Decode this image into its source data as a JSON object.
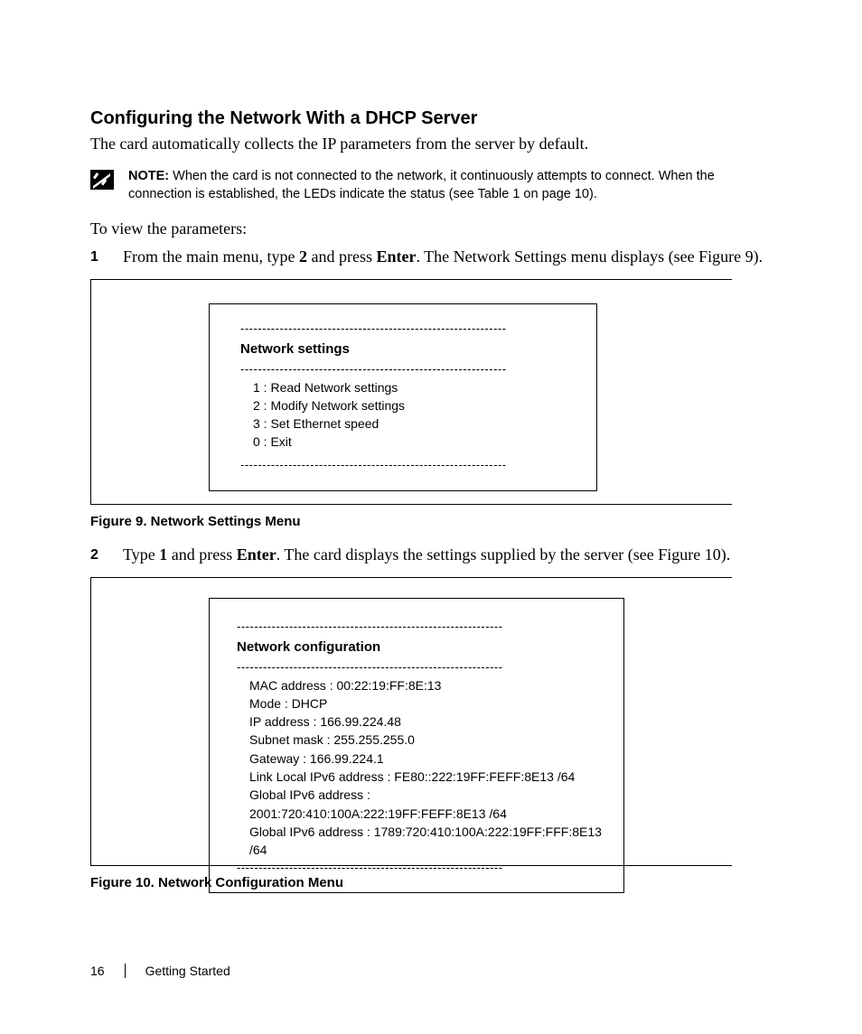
{
  "title": "Configuring the Network With a DHCP Server",
  "intro": "The card automatically collects the IP parameters from the server by default.",
  "note": {
    "label": "NOTE:",
    "text": " When the card is not connected to the network, it continuously attempts to connect. When the connection is established, the LEDs indicate the status (see Table 1 on page 10)."
  },
  "view_params": "To view the parameters:",
  "steps": {
    "1": {
      "num": "1",
      "pre": "From the main menu, type ",
      "key1": "2",
      "mid": " and press ",
      "key2": "Enter",
      "post": ". The Network Settings menu displays (see Figure 9)."
    },
    "2": {
      "num": "2",
      "pre": "Type ",
      "key1": "1",
      "mid": " and press ",
      "key2": "Enter",
      "post": ". The card displays the settings supplied by the server (see Figure 10)."
    }
  },
  "figure9": {
    "dash": "-------------------------------------------------------------",
    "heading": "Network settings",
    "items": [
      "1 : Read Network settings",
      "2 : Modify Network settings",
      "3 : Set Ethernet speed",
      "0 : Exit"
    ],
    "caption": "Figure 9. Network Settings Menu"
  },
  "figure10": {
    "dash": "-------------------------------------------------------------",
    "heading": "Network configuration",
    "items": [
      "MAC address : 00:22:19:FF:8E:13",
      "Mode : DHCP",
      "IP address : 166.99.224.48",
      "Subnet mask : 255.255.255.0",
      "Gateway : 166.99.224.1",
      "Link Local IPv6 address : FE80::222:19FF:FEFF:8E13 /64",
      "Global IPv6 address : 2001:720:410:100A:222:19FF:FEFF:8E13 /64",
      "Global IPv6 address : 1789:720:410:100A:222:19FF:FFF:8E13 /64"
    ],
    "caption": "Figure 10. Network Configuration Menu"
  },
  "footer": {
    "page": "16",
    "section": "Getting Started"
  }
}
